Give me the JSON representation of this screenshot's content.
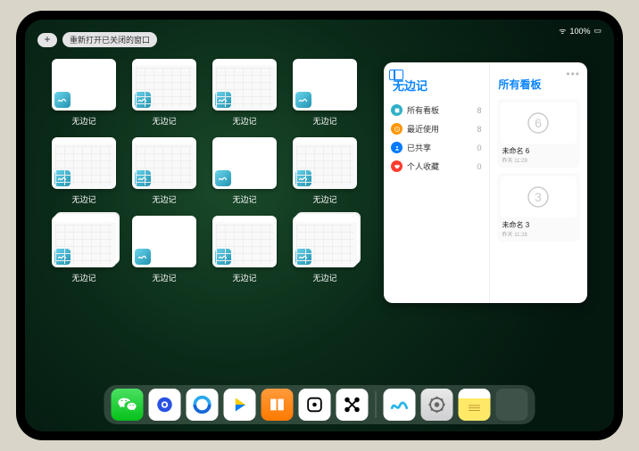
{
  "status": {
    "wifi": "􀙇",
    "battery": "100%"
  },
  "topbar": {
    "plus": "+",
    "reopen_label": "重新打开已关闭的窗口"
  },
  "app_label": "无边记",
  "thumbs": [
    {
      "variant": "blank"
    },
    {
      "variant": "cal"
    },
    {
      "variant": "cal"
    },
    {
      "variant": "blank"
    },
    {
      "variant": "cal"
    },
    {
      "variant": "cal"
    },
    {
      "variant": "blank"
    },
    {
      "variant": "cal"
    },
    {
      "variant": "cal stack"
    },
    {
      "variant": "blank"
    },
    {
      "variant": "cal"
    },
    {
      "variant": "cal stack"
    }
  ],
  "popup": {
    "left_title": "无边记",
    "right_title": "所有看板",
    "categories": [
      {
        "label": "所有看板",
        "count": "8",
        "cls": "b1"
      },
      {
        "label": "最近使用",
        "count": "8",
        "cls": "b2"
      },
      {
        "label": "已共享",
        "count": "0",
        "cls": "b3"
      },
      {
        "label": "个人收藏",
        "count": "0",
        "cls": "b4"
      }
    ],
    "boards": [
      {
        "glyph": "6",
        "title": "未命名 6",
        "date": "昨天 11:29"
      },
      {
        "glyph": "3",
        "title": "未命名 3",
        "date": "昨天 11:28"
      }
    ],
    "ellipsis": "•••"
  },
  "dock": {
    "items": [
      "wechat",
      "eye",
      "browser",
      "play",
      "books",
      "dice",
      "mind"
    ],
    "recent": [
      "freeform",
      "settings",
      "notes",
      "folder"
    ]
  }
}
